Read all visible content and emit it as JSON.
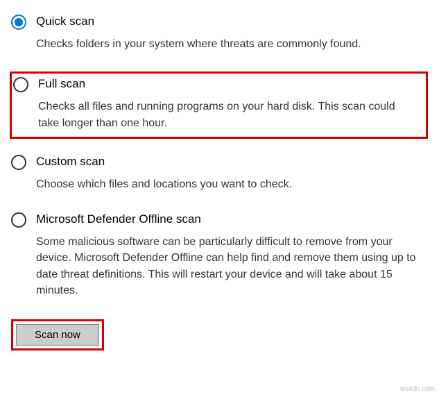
{
  "options": {
    "quick": {
      "label": "Quick scan",
      "desc": "Checks folders in your system where threats are commonly found."
    },
    "full": {
      "label": "Full scan",
      "desc": "Checks all files and running programs on your hard disk. This scan could take longer than one hour."
    },
    "custom": {
      "label": "Custom scan",
      "desc": "Choose which files and locations you want to check."
    },
    "offline": {
      "label": "Microsoft Defender Offline scan",
      "desc": "Some malicious software can be particularly difficult to remove from your device. Microsoft Defender Offline can help find and remove them using up to date threat definitions. This will restart your device and will take about 15 minutes."
    }
  },
  "button": {
    "scan_now": "Scan now"
  },
  "watermark": "wsxdn.com"
}
